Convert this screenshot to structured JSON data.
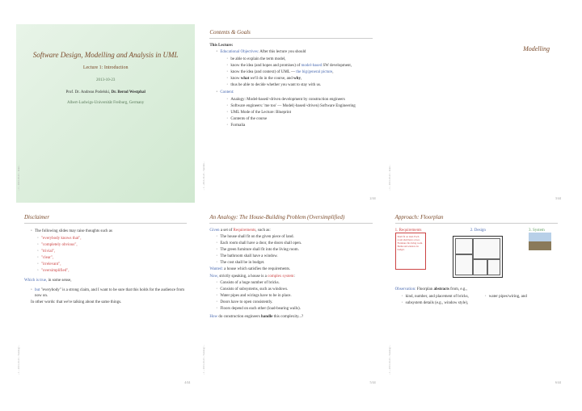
{
  "slide1": {
    "title": "Software Design, Modelling and Analysis in UML",
    "subtitle": "Lecture 1: Introduction",
    "date": "2013-10-23",
    "author_prefix": "Prof. Dr. Andreas Podelski, ",
    "author_bold": "Dr. Bernd Westphal",
    "institution": "Albert-Ludwigs-Universität Freiburg, Germany"
  },
  "slide2": {
    "title": "Contents & Goals",
    "thislecture": "This Lecture:",
    "eduobj": "Educational Objectives:",
    "eduobj_tail": " After this lecture you should",
    "items": [
      "be able to explain the term model,",
      "know the idea (and hopes and promises) of model-based SW development,",
      "know the idea (and context) of UML — the big/general picture,",
      "know what we'll do in the course, and why,",
      "thus be able to decide whether you want to stay with us."
    ],
    "content": "Content:",
    "citems": [
      "Analogy: Model-based/-driven development by construction engineers",
      "Software engineers: 'me too' — Model(-based/-driven) Software Engineering",
      "UML Mode of the Lecture: Blueprint",
      "Contents of the course",
      "Formalia"
    ],
    "page": "2/44"
  },
  "slide3": {
    "title": "Modelling",
    "page": "3/44"
  },
  "slide4": {
    "title": "Disclaimer",
    "intro": "The following slides may raise thoughts such as",
    "thoughts": [
      "\"everybody knows that\",",
      "\"completely obvious\",",
      "\"trivial\",",
      "\"clear\",",
      "\"irrelevant\",",
      "\"oversimplified\","
    ],
    "which": "Which is true,",
    "which_tail": " in some sense,",
    "but": "but",
    "but_tail": " \"everybody\" is a strong claim, and I want to be sure that this holds for the audience from now on.",
    "other": "In other words: that we're talking about the same things.",
    "page": "4/44"
  },
  "slide5": {
    "title": "An Analogy: The House-Building Problem (Oversimplified)",
    "given": "Given",
    "given_tail": " a set of ",
    "reqs": "Requirements",
    "reqs_tail": ", such as:",
    "ritems": [
      "The house shall fit on the given piece of land.",
      "Each room shall have a door, the doors shall open.",
      "The green furniture shall fit into the living room.",
      "The bathroom shall have a window.",
      "The cost shall be in budget."
    ],
    "wanted": "Wanted:",
    "wanted_tail": " a house which satisfies the requirements.",
    "now": "Now,",
    "now_tail": " strictly speaking, a house is a ",
    "complex": "complex system",
    "nitems": [
      "Consists of a huge number of bricks.",
      "Consists of subsystems, such as windows.",
      "Water pipes and wirings have to be in place.",
      "Doors have to open consistently.",
      "Floors depend on each other (load-bearing walls)."
    ],
    "how": "How",
    "how_tail": " do construction engineers handle this complexity...?",
    "page": "5/44"
  },
  "slide6": {
    "title": "Approach: Floorplan",
    "label1": "1. Requirements",
    "label2": "2. Design",
    "label3": "3. System",
    "reqtext": "Shall fit on land\nEach room shall have a door\nFurniture fits living room\nBathroom has window\nWithin budget",
    "obs": "Observation:",
    "obs_tail": " Floorplan abstracts from, e.g.,",
    "oitems": [
      "kind, number, and placement of bricks,",
      "subsystem details (e.g., window style),"
    ],
    "oitem_r": "water pipes/wiring, and",
    "page": "6/44"
  }
}
